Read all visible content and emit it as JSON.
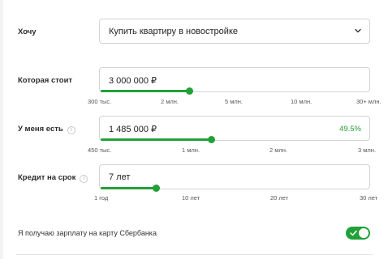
{
  "goal": {
    "label": "Хочу",
    "selected": "Купить квартиру в новостройке"
  },
  "price": {
    "label": "Которая стоит",
    "value": "3 000 000 ₽",
    "fill_fraction": 0.34,
    "ticks": [
      "300 тыс.",
      "2 млн.",
      "5 млн.",
      "10 млн.",
      "30+ млн."
    ]
  },
  "downpayment": {
    "label": "У меня есть",
    "info": "i",
    "value": "1 485 000 ₽",
    "percent": "49.5%",
    "fill_fraction": 0.41,
    "ticks": [
      "450 тыс.",
      "1 млн.",
      "2 млн.",
      "3 млн."
    ]
  },
  "term": {
    "label": "Кредит на срок",
    "info": "i",
    "value": "7 лет",
    "fill_fraction": 0.21,
    "ticks": [
      "1 год",
      "10 лет",
      "20 лет",
      "30 лет"
    ]
  },
  "salary_toggle": {
    "label": "Я получаю зарплату на карту Сбербанка",
    "checked": true
  },
  "colors": {
    "accent": "#21a038",
    "border": "#cfd3d8"
  }
}
